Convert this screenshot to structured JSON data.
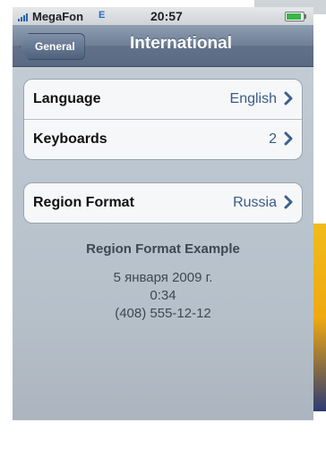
{
  "status_bar": {
    "carrier": "MegaFon",
    "network": "E",
    "time": "20:57"
  },
  "nav": {
    "back_label": "General",
    "title": "International"
  },
  "groups": [
    {
      "rows": [
        {
          "label": "Language",
          "value": "English"
        },
        {
          "label": "Keyboards",
          "value": "2"
        }
      ]
    },
    {
      "rows": [
        {
          "label": "Region Format",
          "value": "Russia"
        }
      ]
    }
  ],
  "region_example": {
    "title": "Region Format Example",
    "date": "5 января 2009 г.",
    "time": "0:34",
    "phone": "(408) 555-12-12"
  },
  "icons": {
    "signal": "signal-bars-icon",
    "battery": "battery-icon",
    "chevron": "chevron-right-icon"
  },
  "colors": {
    "nav_bar": "#6f7f96",
    "value_text": "#395c8a",
    "battery_fill": "#39b54a"
  }
}
